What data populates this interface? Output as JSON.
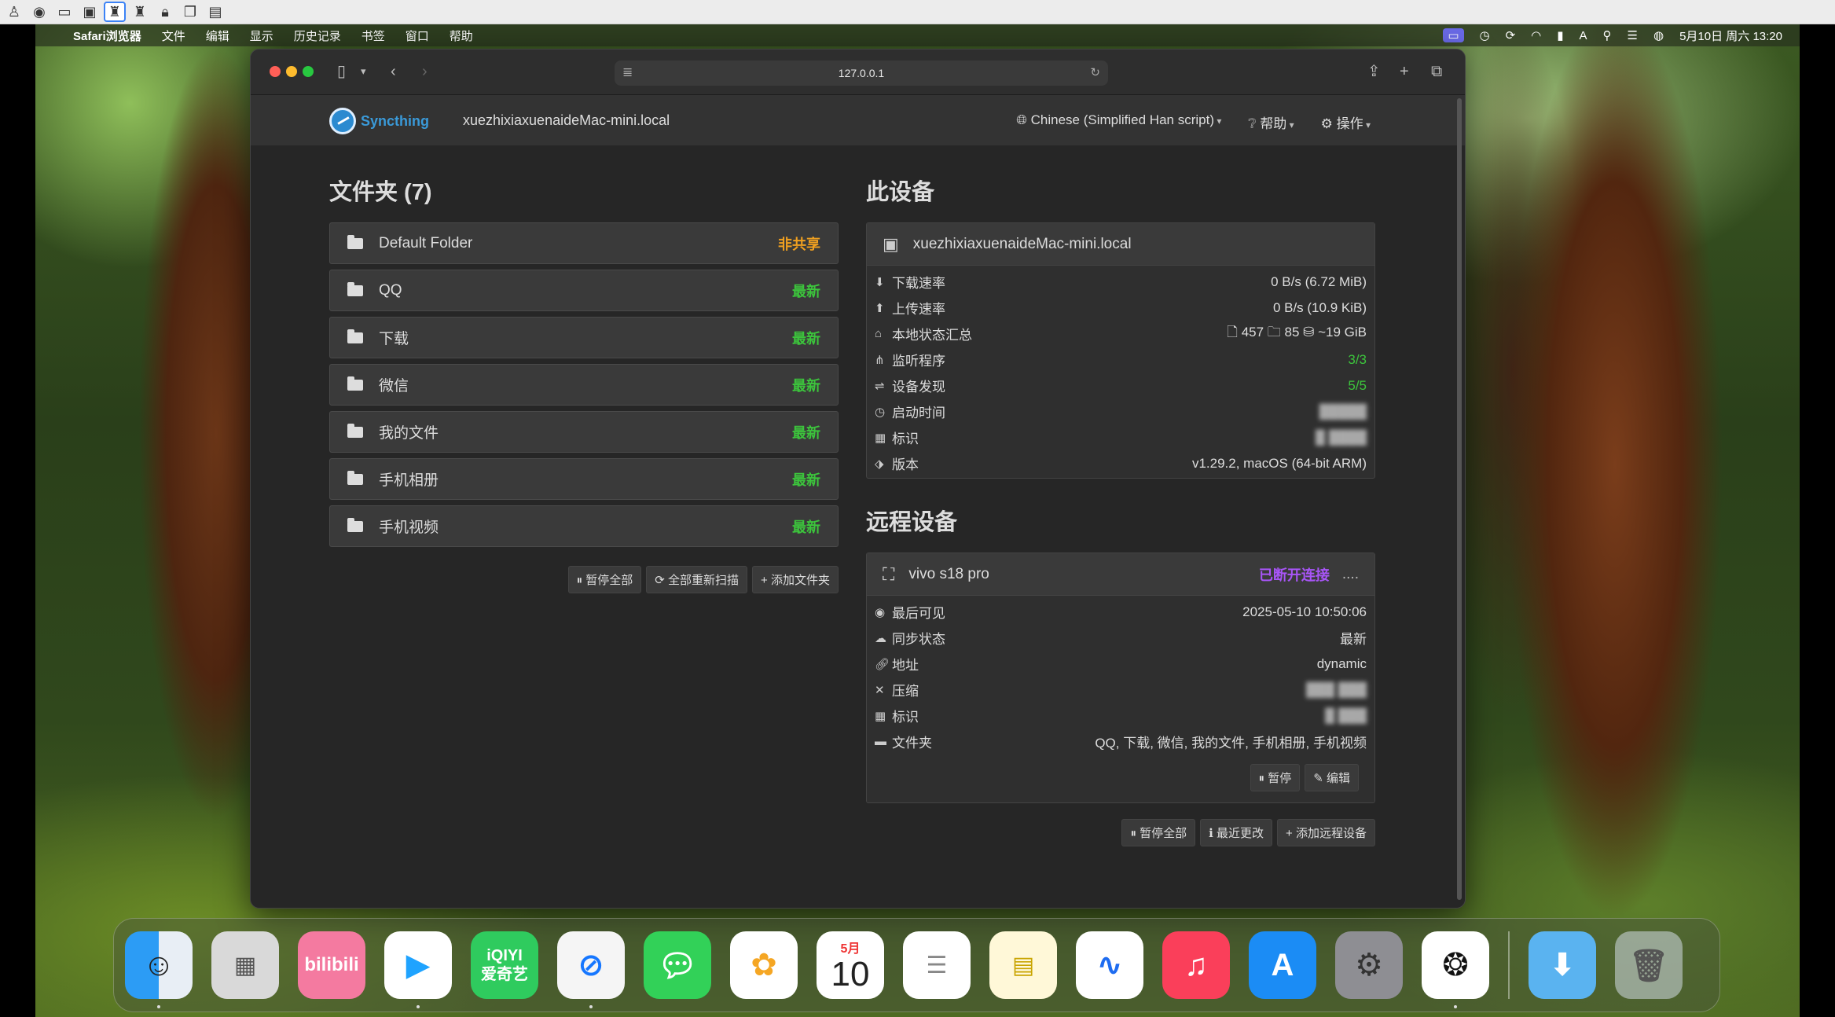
{
  "menubar": {
    "app": "Safari浏览器",
    "items": [
      "文件",
      "编辑",
      "显示",
      "历史记录",
      "书签",
      "窗口",
      "帮助"
    ],
    "clock": "5月10日 周六 13:20"
  },
  "browser": {
    "url": "127.0.0.1"
  },
  "syncthing": {
    "brand": "Syncthing",
    "hostname": "xuezhixiaxuenaideMac-mini.local",
    "nav": [
      "Chinese (Simplified Han script)",
      "帮助",
      "操作"
    ],
    "folders_title": "文件夹 (7)",
    "folders": [
      {
        "name": "Default Folder",
        "status": "非共享",
        "status_color": "#f0a020"
      },
      {
        "name": "QQ",
        "status": "最新",
        "status_color": "#3cc43c"
      },
      {
        "name": "下载",
        "status": "最新",
        "status_color": "#3cc43c"
      },
      {
        "name": "微信",
        "status": "最新",
        "status_color": "#3cc43c"
      },
      {
        "name": "我的文件",
        "status": "最新",
        "status_color": "#3cc43c"
      },
      {
        "name": "手机相册",
        "status": "最新",
        "status_color": "#3cc43c"
      },
      {
        "name": "手机视频",
        "status": "最新",
        "status_color": "#3cc43c"
      }
    ],
    "folder_buttons": [
      "暂停全部",
      "全部重新扫描",
      "添加文件夹"
    ],
    "this_device_title": "此设备",
    "this_device": {
      "name": "xuezhixiaxuenaideMac-mini.local",
      "rows": [
        {
          "label": "下载速率",
          "value": "0 B/s (6.72 MiB)"
        },
        {
          "label": "上传速率",
          "value": "0 B/s (10.9 KiB)"
        },
        {
          "label": "本地状态汇总",
          "value": "🗋 457  🗀 85  ⛁ ~19 GiB"
        },
        {
          "label": "监听程序",
          "value": "3/3"
        },
        {
          "label": "设备发现",
          "value": "5/5"
        },
        {
          "label": "启动时间",
          "value": "█████"
        },
        {
          "label": "标识",
          "value": "█ ████"
        },
        {
          "label": "版本",
          "value": "v1.29.2, macOS (64-bit ARM)"
        }
      ]
    },
    "remote_title": "远程设备",
    "remote": {
      "name": "vivo s18 pro",
      "status": "已断开连接",
      "dots": "....",
      "rows": [
        {
          "label": "最后可见",
          "value": "2025-05-10 10:50:06"
        },
        {
          "label": "同步状态",
          "value": "最新"
        },
        {
          "label": "地址",
          "value": "dynamic"
        },
        {
          "label": "压缩",
          "value": "███ ███"
        },
        {
          "label": "标识",
          "value": "█ ███"
        },
        {
          "label": "文件夹",
          "value": "QQ, 下载, 微信, 我的文件, 手机相册, 手机视频"
        }
      ],
      "buttons": [
        "暂停",
        "编辑"
      ]
    },
    "remote_buttons": [
      "暂停全部",
      "最近更改",
      "添加远程设备"
    ]
  },
  "dock": {
    "calendar_month": "5月",
    "calendar_day": "10",
    "iqiyi": "iQIYI\n爱奇艺",
    "bilibili": "bilibili"
  }
}
